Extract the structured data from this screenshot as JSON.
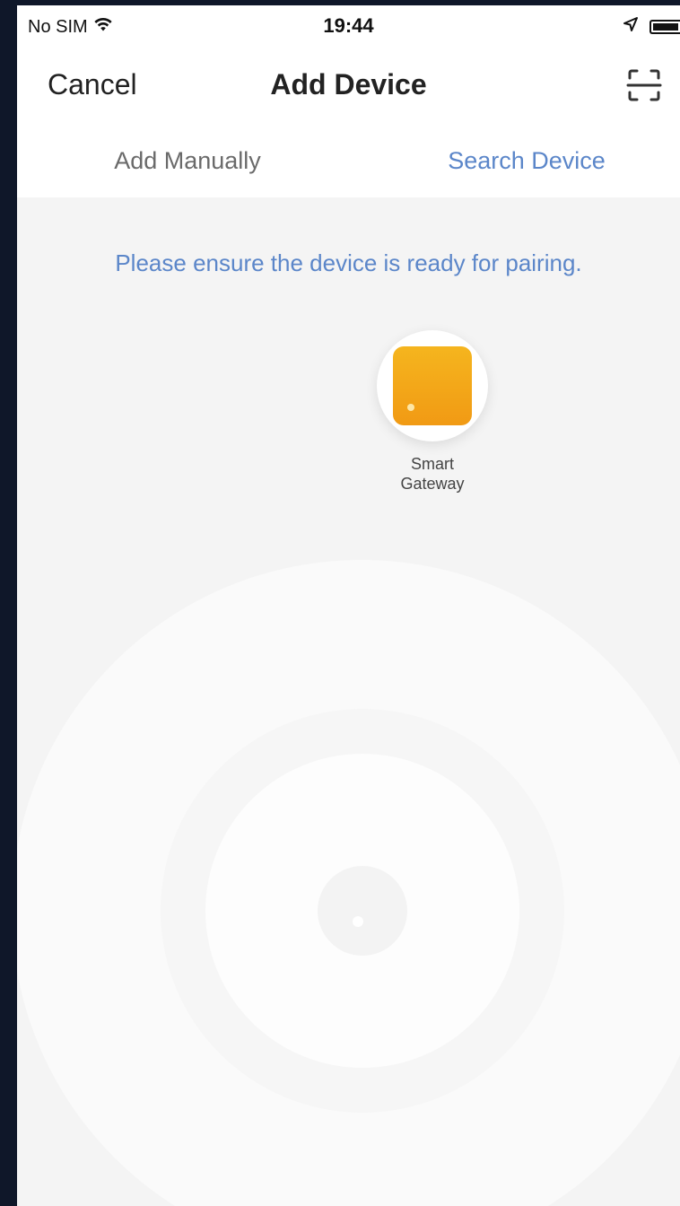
{
  "status_bar": {
    "carrier": "No SIM",
    "wifi_icon": "wifi-icon",
    "time": "19:44",
    "location_icon": "location-arrow-icon",
    "battery_icon": "battery-icon"
  },
  "nav": {
    "cancel_label": "Cancel",
    "title": "Add Device",
    "scan_icon": "scan-icon"
  },
  "tabs": [
    {
      "label": "Add Manually",
      "active": false
    },
    {
      "label": "Search Device",
      "active": true
    }
  ],
  "hint": "Please ensure the device is ready for pairing.",
  "found_devices": [
    {
      "name": "Smart\nGateway",
      "icon": "gateway-icon",
      "color": "#f4a81a"
    }
  ],
  "colors": {
    "accent": "#5b86c9",
    "background": "#f4f4f4",
    "frame": "#0f1729"
  }
}
